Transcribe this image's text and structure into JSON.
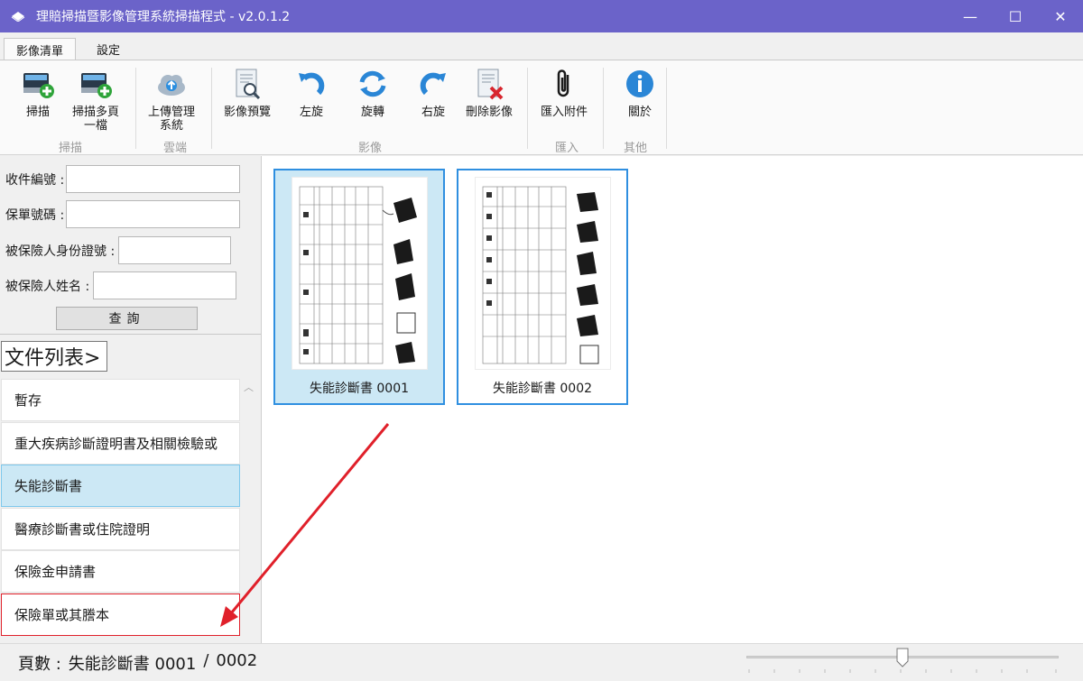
{
  "window": {
    "title": "理賠掃描暨影像管理系統掃描程式 - v2.0.1.2",
    "minimize": "—",
    "maximize": "☐",
    "close": "✕"
  },
  "tabs": [
    {
      "label": "影像清單",
      "active": true
    },
    {
      "label": "設定",
      "active": false
    }
  ],
  "ribbon": {
    "buttons": [
      {
        "label": "掃描",
        "icon": "scanner-add-icon"
      },
      {
        "label": "掃描多頁一檔",
        "line1": "掃描多頁",
        "line2": "一檔",
        "icon": "scanner-multi-icon"
      },
      {
        "label": "上傳管理系統",
        "line1": "上傳管理",
        "line2": "系統",
        "icon": "cloud-upload-icon"
      },
      {
        "label": "影像預覽",
        "icon": "preview-icon"
      },
      {
        "label": "左旋",
        "icon": "rotate-left-icon"
      },
      {
        "label": "旋轉",
        "icon": "rotate-icon"
      },
      {
        "label": "右旋",
        "icon": "rotate-right-icon"
      },
      {
        "label": "刪除影像",
        "icon": "delete-image-icon"
      },
      {
        "label": "匯入附件",
        "icon": "paperclip-icon"
      },
      {
        "label": "關於",
        "icon": "info-icon"
      }
    ],
    "groups": [
      "掃描",
      "雲端",
      "影像",
      "匯入",
      "其他"
    ]
  },
  "search": {
    "case_no_label": "收件編號 :",
    "policy_no_label": "保單號碼 :",
    "insured_id_label": "被保險人身份證號 :",
    "insured_name_label": "被保險人姓名 :",
    "query_button": "查詢"
  },
  "doclist": {
    "label": "文件列表>",
    "items": [
      {
        "label": "暫存",
        "selected": false
      },
      {
        "label": "重大疾病診斷證明書及相關檢驗或",
        "selected": false
      },
      {
        "label": "失能診斷書",
        "selected": true
      },
      {
        "label": "醫療診斷書或住院證明",
        "selected": false
      },
      {
        "label": "保險金申請書",
        "selected": false
      },
      {
        "label": "保險單或其謄本",
        "selected": false,
        "highlighted": true
      }
    ]
  },
  "thumbnails": [
    {
      "caption": "失能診斷書 0001",
      "selected": true
    },
    {
      "caption": "失能診斷書 0002",
      "selected": false
    }
  ],
  "status": {
    "pages_label": "頁數 :",
    "current": "失能診斷書 0001",
    "separator": "/",
    "total": "0002"
  },
  "colors": {
    "titlebar": "#6b63c9",
    "selection": "#cce8f5",
    "thumb_border": "#2f8fe0",
    "annotation": "#e0202a"
  }
}
